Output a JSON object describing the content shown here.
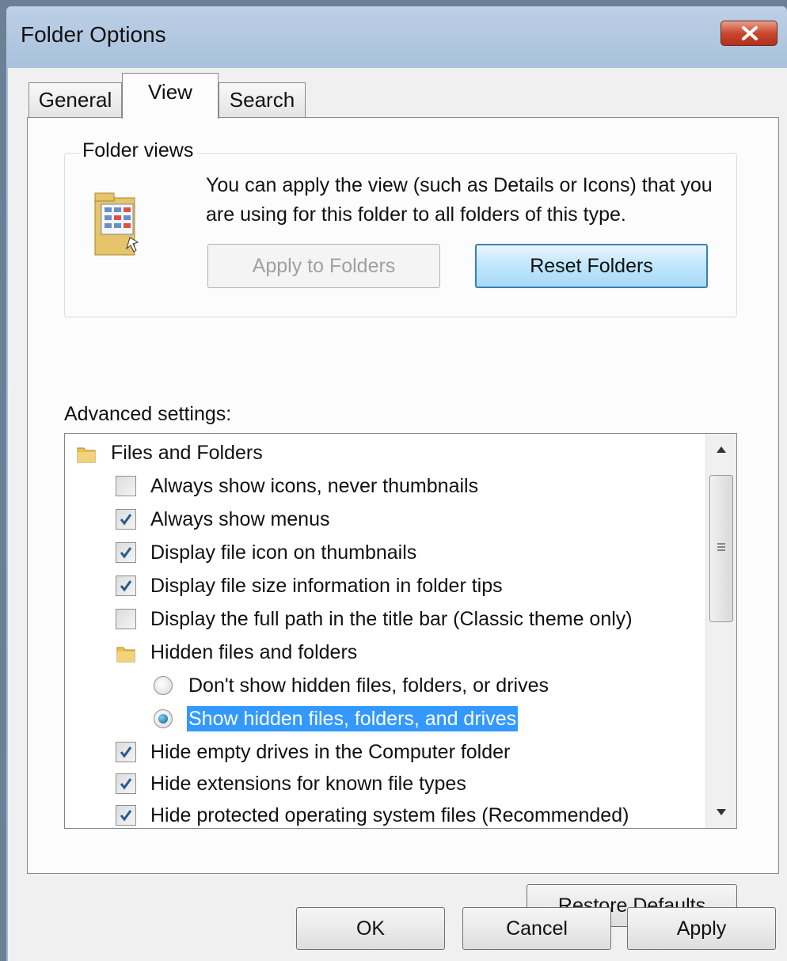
{
  "window": {
    "title": "Folder Options"
  },
  "tabs": [
    {
      "label": "General",
      "selected": false
    },
    {
      "label": "View",
      "selected": true
    },
    {
      "label": "Search",
      "selected": false
    }
  ],
  "folder_views": {
    "legend": "Folder views",
    "description": "You can apply the view (such as Details or Icons) that you are using for this folder to all folders of this type.",
    "apply_button": "Apply to Folders",
    "reset_button": "Reset Folders"
  },
  "advanced": {
    "label": "Advanced settings:",
    "items": [
      {
        "type": "folder",
        "label": "Files and Folders"
      },
      {
        "type": "checkbox",
        "label": "Always show icons, never thumbnails",
        "checked": false
      },
      {
        "type": "checkbox",
        "label": "Always show menus",
        "checked": true
      },
      {
        "type": "checkbox",
        "label": "Display file icon on thumbnails",
        "checked": true
      },
      {
        "type": "checkbox",
        "label": "Display file size information in folder tips",
        "checked": true
      },
      {
        "type": "checkbox",
        "label": "Display the full path in the title bar (Classic theme only)",
        "checked": false
      },
      {
        "type": "folder",
        "label": "Hidden files and folders"
      },
      {
        "type": "radio",
        "label": "Don't show hidden files, folders, or drives",
        "selected": false
      },
      {
        "type": "radio",
        "label": "Show hidden files, folders, and drives",
        "selected": true
      },
      {
        "type": "checkbox",
        "label": "Hide empty drives in the Computer folder",
        "checked": true
      },
      {
        "type": "checkbox",
        "label": "Hide extensions for known file types",
        "checked": true
      },
      {
        "type": "checkbox",
        "label": "Hide protected operating system files (Recommended)",
        "checked": true
      }
    ]
  },
  "restore_defaults": "Restore Defaults",
  "footer": {
    "ok": "OK",
    "cancel": "Cancel",
    "apply": "Apply"
  }
}
